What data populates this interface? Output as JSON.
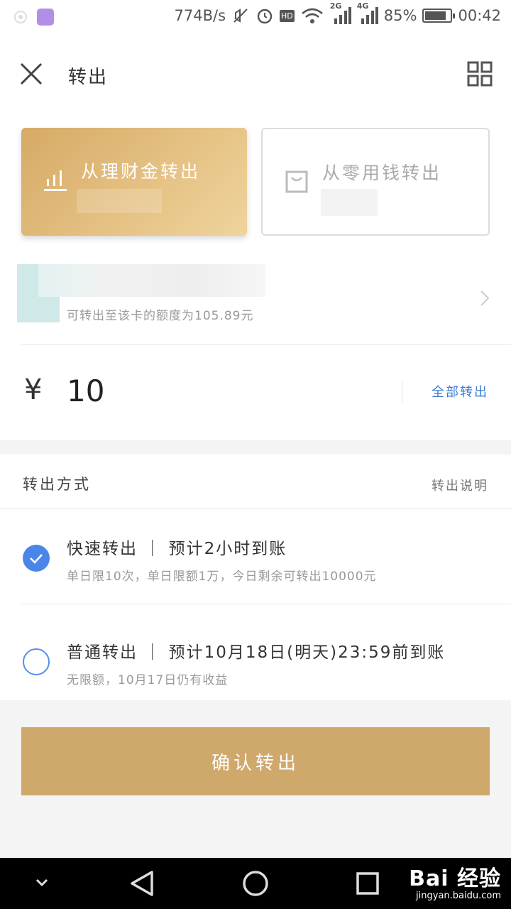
{
  "status_bar": {
    "speed": "774B/s",
    "net_2g": "2G",
    "net_4g": "4G",
    "battery": "85%",
    "battery_level": 0.85,
    "time": "00:42",
    "hd": "HD"
  },
  "header": {
    "title": "转出"
  },
  "sources": [
    {
      "label": "从理财金转出",
      "selected": true,
      "icon": "bar-chart-icon"
    },
    {
      "label": "从零用钱转出",
      "selected": false,
      "icon": "pocket-icon"
    }
  ],
  "bank": {
    "limit_note": "可转出至该卡的额度为105.89元"
  },
  "amount": {
    "currency": "¥",
    "value": "10",
    "all_label": "全部转出"
  },
  "method": {
    "title": "转出方式",
    "help": "转出说明",
    "options": [
      {
        "name": "快速转出 ｜ 预计2小时到账",
        "desc": "单日限10次，单日限额1万，今日剩余可转出10000元",
        "selected": true
      },
      {
        "name": "普通转出 ｜ 预计10月18日(明天)23:59前到账",
        "desc": "无限额，10月17日仍有收益",
        "selected": false
      }
    ]
  },
  "confirm_label": "确认转出",
  "watermark": {
    "big": "Bai 经验",
    "small": "jingyan.baidu.com"
  },
  "colors": {
    "gold": "#cfa86c",
    "blue": "#4a86e8",
    "link": "#3a7ad9"
  }
}
